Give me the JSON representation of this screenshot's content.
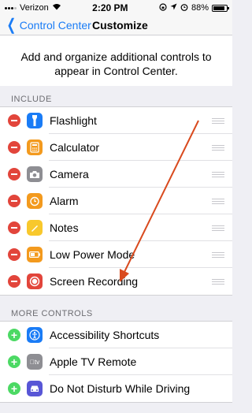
{
  "status_bar": {
    "carrier": "Verizon",
    "time": "2:20 PM",
    "battery": "88%",
    "battery_level": 0.88
  },
  "nav": {
    "back_label": "Control Center",
    "title": "Customize"
  },
  "intro": "Add and organize additional controls to appear in Control Center.",
  "include": {
    "header": "INCLUDE",
    "items": [
      {
        "label": "Flashlight",
        "icon": "flashlight-icon",
        "color": "#1a7cf6"
      },
      {
        "label": "Calculator",
        "icon": "calculator-icon",
        "color": "#f39a1e"
      },
      {
        "label": "Camera",
        "icon": "camera-icon",
        "color": "#8e8e93"
      },
      {
        "label": "Alarm",
        "icon": "alarm-icon",
        "color": "#f39a1e"
      },
      {
        "label": "Notes",
        "icon": "notes-icon",
        "color": "#f8c82c"
      },
      {
        "label": "Low Power Mode",
        "icon": "battery-icon",
        "color": "#f39a1e"
      },
      {
        "label": "Screen Recording",
        "icon": "record-icon",
        "color": "#e2453b"
      }
    ]
  },
  "more": {
    "header": "MORE CONTROLS",
    "items": [
      {
        "label": "Accessibility Shortcuts",
        "icon": "accessibility-icon",
        "color": "#1a7cf6"
      },
      {
        "label": "Apple TV Remote",
        "icon": "apple-tv-icon",
        "color": "#8e8e93"
      },
      {
        "label": "Do Not Disturb While Driving",
        "icon": "car-icon",
        "color": "#5856d6"
      }
    ]
  },
  "annotation_color": "#d94a1e"
}
